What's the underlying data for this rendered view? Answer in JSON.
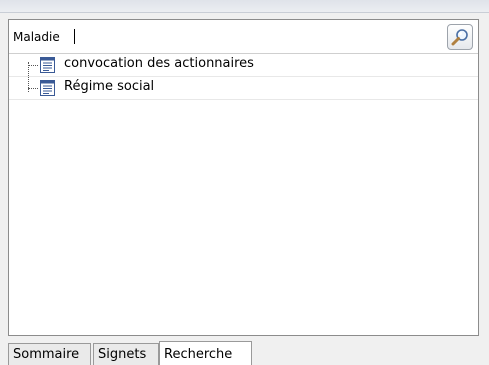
{
  "search": {
    "value": "Maladie",
    "button_icon": "magnifier-icon"
  },
  "results": [
    {
      "label": "convocation des actionnaires",
      "icon": "document-icon"
    },
    {
      "label": "Régime social",
      "icon": "document-icon"
    }
  ],
  "tabs": [
    {
      "label": "Sommaire",
      "active": false
    },
    {
      "label": "Signets",
      "active": false
    },
    {
      "label": "Recherche",
      "active": true
    }
  ]
}
